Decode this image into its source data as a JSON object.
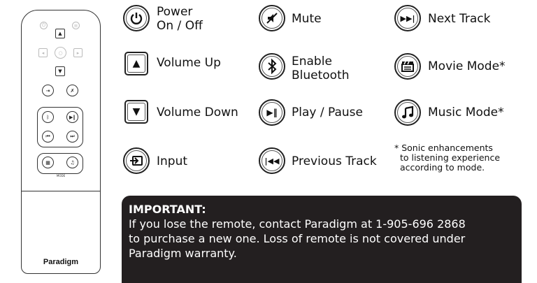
{
  "remote": {
    "brand": "Paradigm",
    "mode_label": "MODE"
  },
  "legend": {
    "power": "Power\nOn / Off",
    "volume_up": "Volume Up",
    "volume_down": "Volume Down",
    "input": "Input",
    "mute": "Mute",
    "bluetooth": "Enable\nBluetooth",
    "play_pause": "Play / Pause",
    "previous_track": "Previous Track",
    "next_track": "Next Track",
    "movie_mode": "Movie Mode*",
    "music_mode": "Music Mode*"
  },
  "footnote": "* Sonic enhancements\n  to listening experience\n  according to mode.",
  "important": {
    "heading": "IMPORTANT:",
    "line1": "If you lose the remote, contact Paradigm at 1-905-696 2868",
    "line2": "to purchase a new one.  Loss of  remote is not covered under",
    "line3": "Paradigm warranty."
  },
  "icons": [
    "power-icon",
    "volume-up-icon",
    "volume-down-icon",
    "input-icon",
    "mute-icon",
    "bluetooth-icon",
    "play-pause-icon",
    "previous-track-icon",
    "next-track-icon",
    "movie-mode-icon",
    "music-mode-icon"
  ]
}
